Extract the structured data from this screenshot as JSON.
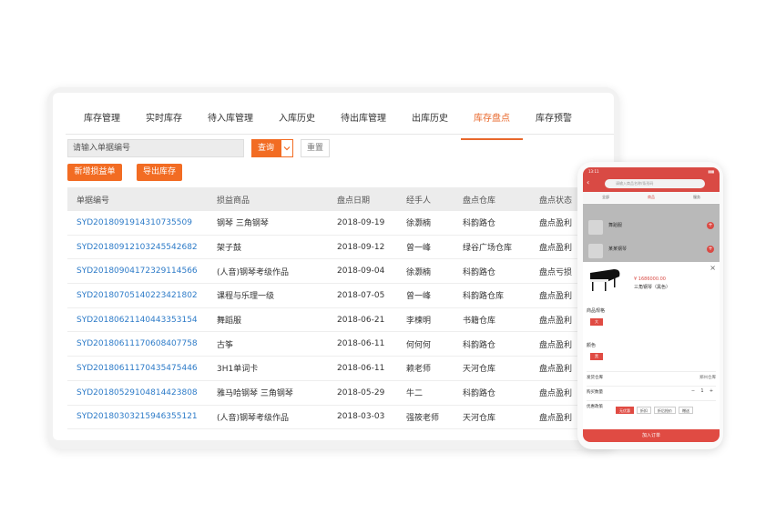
{
  "tabs": [
    "库存管理",
    "实时库存",
    "待入库管理",
    "入库历史",
    "待出库管理",
    "出库历史",
    "库存盘点",
    "库存预警"
  ],
  "active_tab": 6,
  "search": {
    "placeholder": "请输入单据编号"
  },
  "buttons": {
    "query": "查询",
    "dropdown_icon": "chevron-down",
    "reset": "重置",
    "add": "新增损益单",
    "export": "导出库存"
  },
  "table": {
    "headers": [
      "单据编号",
      "损益商品",
      "盘点日期",
      "经手人",
      "盘点仓库",
      "盘点状态"
    ],
    "rows": [
      [
        "SYD2018091914310735509",
        "钢琴 三角钢琴",
        "2018-09-19",
        "徐灏楠",
        "科韵路仓",
        "盘点盈利"
      ],
      [
        "SYD20180912103245542682",
        "架子鼓",
        "2018-09-12",
        "曾一峰",
        "绿谷广场仓库",
        "盘点盈利"
      ],
      [
        "SYD20180904172329114566",
        "(人音)钢琴考级作品",
        "2018-09-04",
        "徐灏楠",
        "科韵路仓",
        "盘点亏损"
      ],
      [
        "SYD20180705140223421802",
        "课程与乐理一级",
        "2018-07-05",
        "曾一峰",
        "科韵路仓库",
        "盘点盈利"
      ],
      [
        "SYD20180621140443353154",
        "舞蹈服",
        "2018-06-21",
        "李楝明",
        "书籍仓库",
        "盘点盈利"
      ],
      [
        "SYD20180611170608407758",
        "古筝",
        "2018-06-11",
        "何何何",
        "科韵路仓",
        "盘点盈利"
      ],
      [
        "SYD20180611170435475446",
        "3H1单词卡",
        "2018-06-11",
        "赖老师",
        "天河仓库",
        "盘点盈利"
      ],
      [
        "SYD20180529104814423808",
        "雅马哈钢琴 三角钢琴",
        "2018-05-29",
        "牛二",
        "科韵路仓",
        "盘点盈利"
      ],
      [
        "SYD20180303215946355121",
        "(人音)钢琴考级作品",
        "2018-03-03",
        "强筱老师",
        "天河仓库",
        "盘点盈利"
      ]
    ]
  },
  "phone": {
    "status_time": "13:11",
    "search_placeholder": "请输入商品名称/条形码",
    "tabs": [
      "全部",
      "商品",
      "服务"
    ],
    "list_items": [
      "舞蹈服",
      "某某钢琴"
    ],
    "price": "¥ 1686000.00",
    "product_name": "三角钢琴（黑色）",
    "spec_label": "商品规格",
    "spec_value": "大",
    "color_label": "颜色",
    "color_value": "黑",
    "warehouse_label": "发货仓库",
    "warehouse_value": "郑州仓库",
    "qty_label": "购买数量",
    "qty_value": "1",
    "promo_label": "优惠政策",
    "promos": [
      "无优惠",
      "折扣",
      "折后抢价",
      "赠送"
    ],
    "cta": "加入订单"
  },
  "colors": {
    "accent": "#f26c23",
    "link": "#2d7bc8",
    "phone_red": "#e04b43"
  }
}
